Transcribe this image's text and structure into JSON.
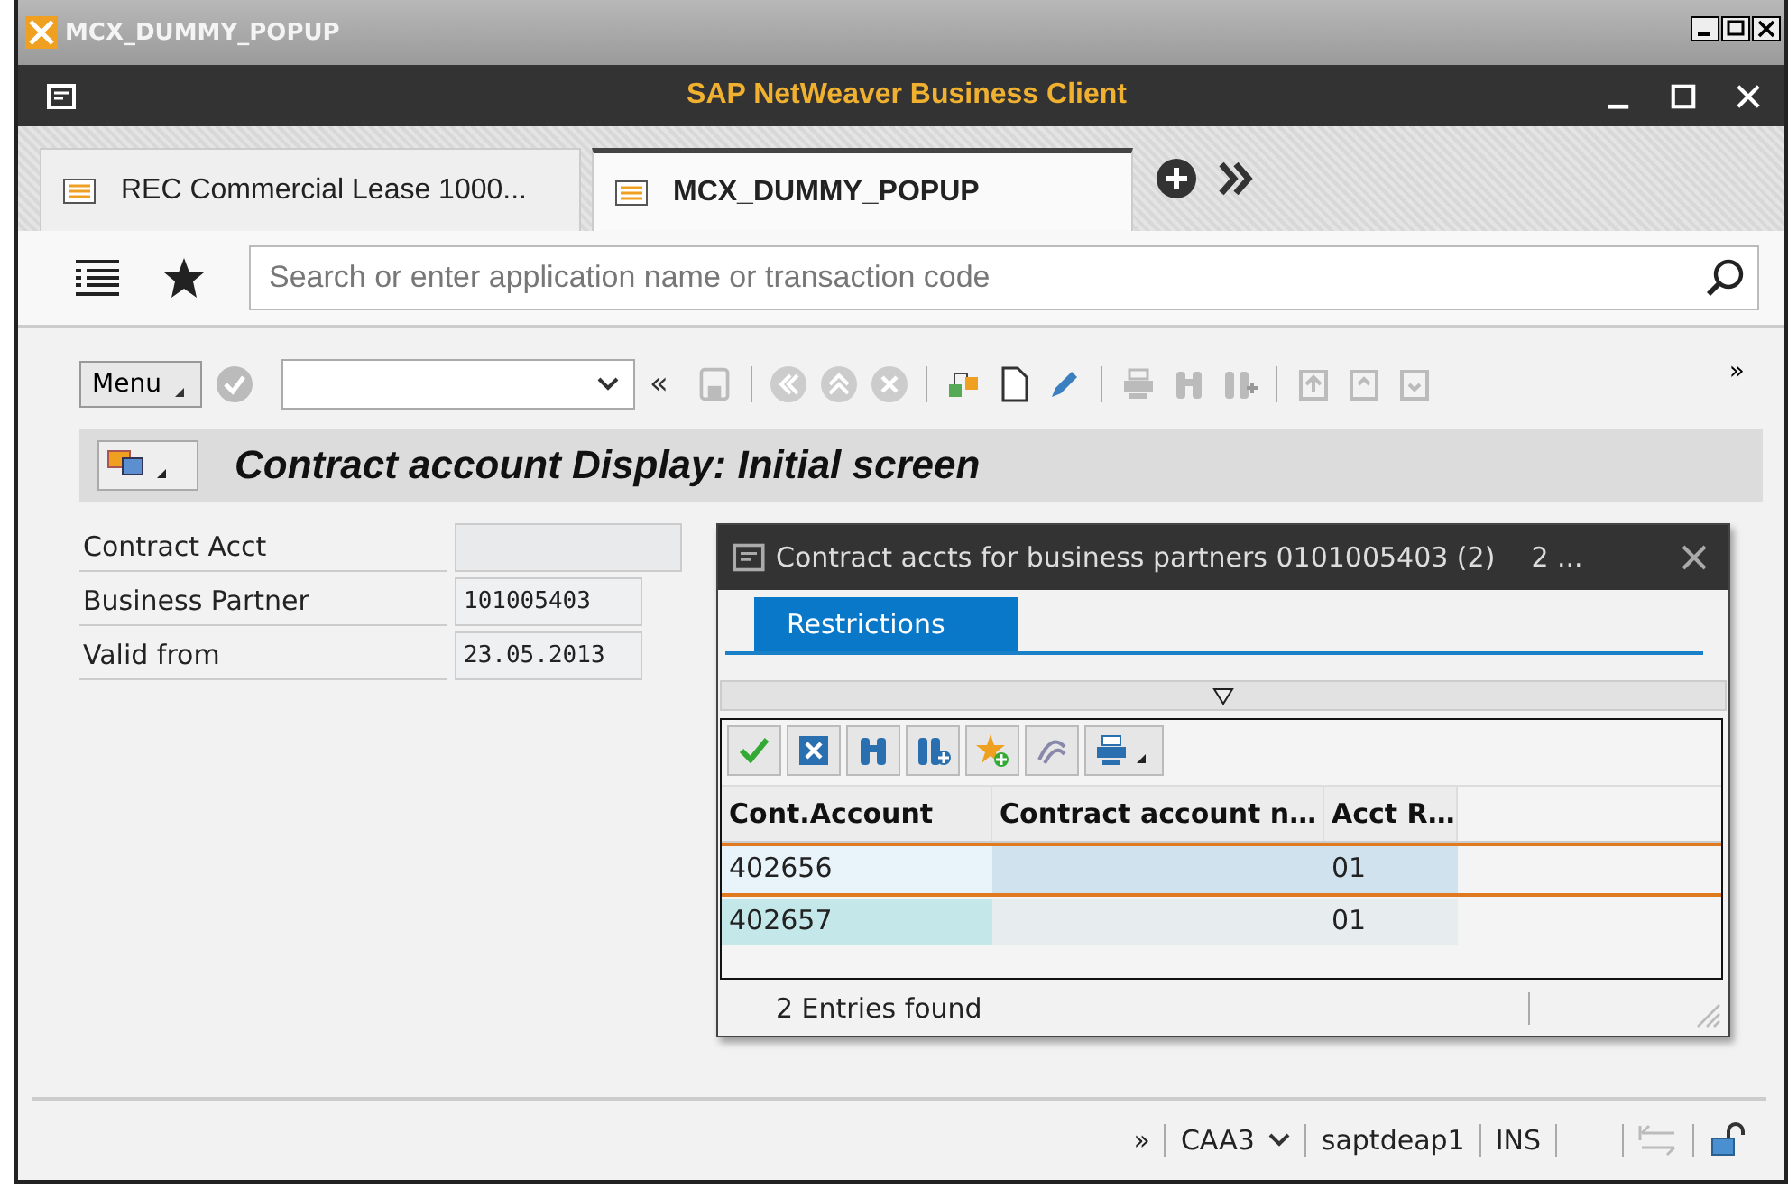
{
  "outer_window": {
    "title": "MCX_DUMMY_POPUP"
  },
  "app_bar": {
    "title": "SAP NetWeaver Business Client"
  },
  "tabs": [
    {
      "label": "REC Commercial Lease 1000...",
      "selected": false
    },
    {
      "label": "MCX_DUMMY_POPUP",
      "selected": true
    }
  ],
  "search": {
    "placeholder": "Search or enter application name or transaction code"
  },
  "toolbar": {
    "menu": "Menu",
    "collapse": "«",
    "more": "»"
  },
  "screen_title": "Contract account Display: Initial screen",
  "fields": [
    {
      "label": "Contract Acct",
      "wide": true
    },
    {
      "label": "Business Partner",
      "value": "101005403",
      "wide": false
    },
    {
      "label": "Valid from",
      "value": "23.05.2013",
      "wide": false
    }
  ],
  "popup": {
    "title": "Contract accts for business partners 0101005403 (2)",
    "title_extra": "2 ...",
    "tabs": [
      {
        "label": "Restrictions",
        "selected": true
      }
    ],
    "columns": [
      "Cont.Account",
      "Contract account n…",
      "Acct R…"
    ],
    "rows": [
      {
        "account": "402656",
        "acct_r": "01",
        "selected": true
      },
      {
        "account": "402657",
        "acct_r": "01",
        "selected": false
      }
    ],
    "status": "2 Entries found"
  },
  "status_bar": {
    "more": "»",
    "system": "CAA3",
    "server": "saptdeap1",
    "mode": "INS"
  }
}
